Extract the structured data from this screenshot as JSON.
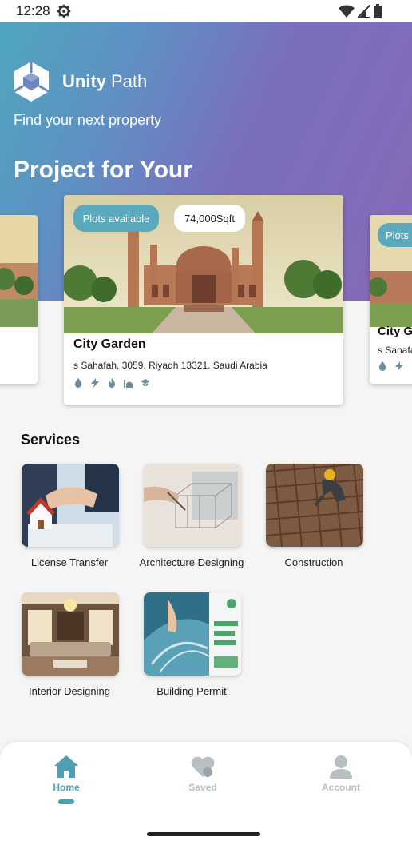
{
  "status_bar": {
    "time": "12:28"
  },
  "brand": {
    "name_bold": "Unity",
    "name_light": "Path"
  },
  "hero": {
    "tagline": "Find your next property",
    "title": "Project for Your"
  },
  "projects": {
    "main": {
      "status_pill": "Plots available",
      "area_pill": "74,000Sqft",
      "name": "City Garden",
      "address": "s Sahafah, 3059. Riyadh 13321. Saudi Arabia"
    },
    "peek_right": {
      "status_pill": "Plots a",
      "name": "City G",
      "address": "s Sahafa"
    },
    "amenities": [
      "water-icon",
      "electricity-icon",
      "gas-icon",
      "mosque-icon",
      "school-icon"
    ]
  },
  "services": {
    "title": "Services",
    "items": [
      {
        "label": "License Transfer"
      },
      {
        "label": "Architecture Designing"
      },
      {
        "label": "Construction"
      },
      {
        "label": "Interior Designing"
      },
      {
        "label": "Building Permit"
      }
    ]
  },
  "nav": {
    "items": [
      {
        "label": "Home",
        "active": true
      },
      {
        "label": "Saved",
        "active": false
      },
      {
        "label": "Account",
        "active": false
      }
    ]
  },
  "colors": {
    "accent": "#4f9fb5",
    "hero_start": "#4fa6bd",
    "hero_end": "#876ab9",
    "inactive": "#b8c0c4"
  }
}
